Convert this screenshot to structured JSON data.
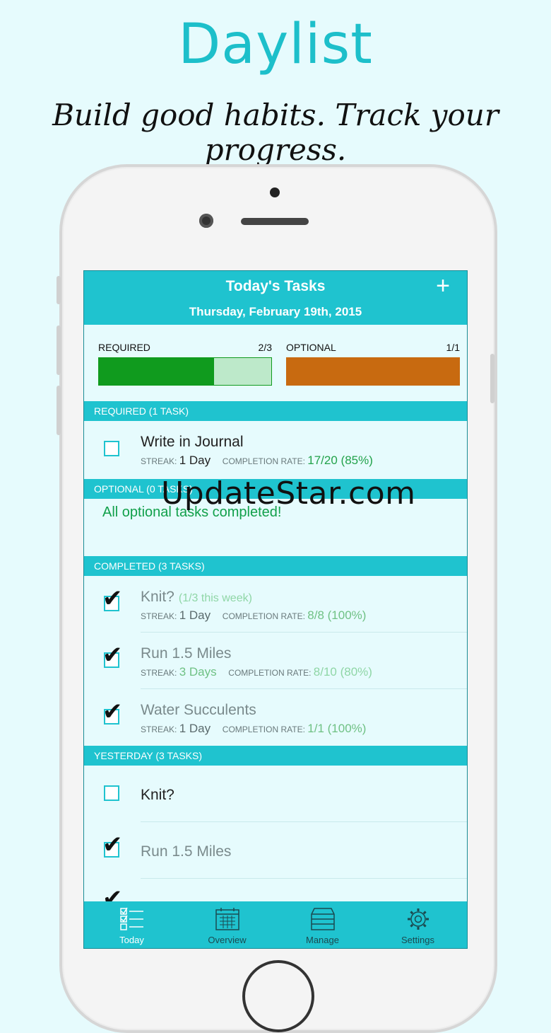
{
  "promo": {
    "title": "Daylist",
    "subtitle": "Build good habits. Track your progress."
  },
  "navbar": {
    "title": "Today's Tasks",
    "date": "Thursday, February 19th, 2015",
    "add_icon": "plus-icon"
  },
  "progress": {
    "required": {
      "label": "REQUIRED",
      "count": "2/3",
      "fraction": 0.667,
      "color": "#109b1e",
      "track_color": "#bde9ca"
    },
    "optional": {
      "label": "OPTIONAL",
      "count": "1/1",
      "fraction": 1.0,
      "color": "#c86a10",
      "track_color": "#f0c79a"
    }
  },
  "sections": {
    "required": "REQUIRED (1 TASK)",
    "optional": "OPTIONAL (0 TASKS)",
    "completed": "COMPLETED (3 TASKS)",
    "yesterday": "YESTERDAY (3 TASKS)"
  },
  "labels": {
    "streak": "STREAK:",
    "completion_rate": "COMPLETION RATE:"
  },
  "required_tasks": [
    {
      "name": "Write in Journal",
      "streak": "1 Day",
      "rate": "17/20 (85%)"
    }
  ],
  "optional_message": "All optional tasks completed!",
  "completed_tasks": [
    {
      "name": "Knit?",
      "extra": "(1/3 this week)",
      "streak": "1 Day",
      "rate": "8/8 (100%)"
    },
    {
      "name": "Run 1.5 Miles",
      "streak": "3 Days",
      "rate": "8/10 (80%)"
    },
    {
      "name": "Water Succulents",
      "streak": "1 Day",
      "rate": "1/1 (100%)"
    }
  ],
  "yesterday_tasks": [
    {
      "name": "Knit?",
      "checked": false
    },
    {
      "name": "Run 1.5 Miles",
      "checked": true
    }
  ],
  "tabs": [
    {
      "label": "Today",
      "icon": "checklist-icon",
      "active": true
    },
    {
      "label": "Overview",
      "icon": "calendar-icon",
      "active": false
    },
    {
      "label": "Manage",
      "icon": "database-icon",
      "active": false
    },
    {
      "label": "Settings",
      "icon": "gear-icon",
      "active": false
    }
  ],
  "watermark": "UpdateStar.com",
  "colors": {
    "accent": "#1fc3cf",
    "background": "#e6fbfd"
  }
}
